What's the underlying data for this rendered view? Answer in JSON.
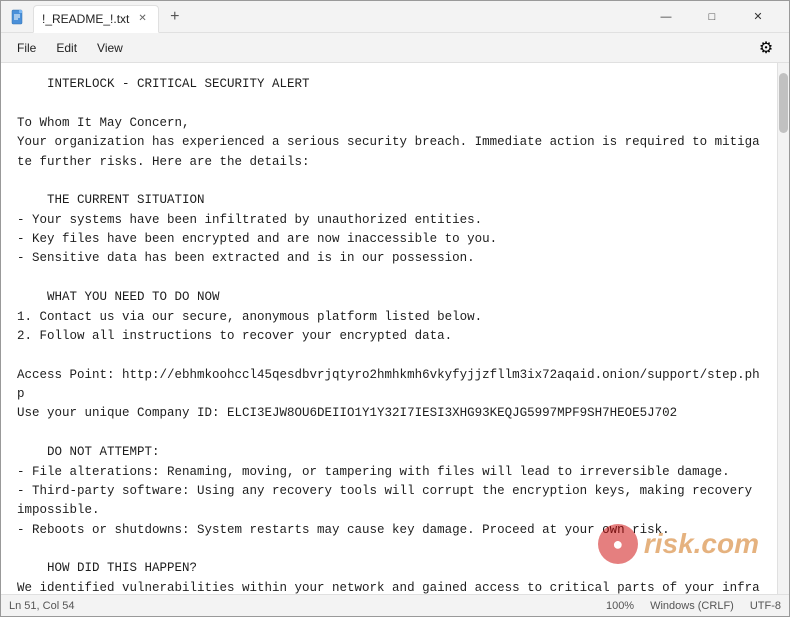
{
  "window": {
    "title": "!_README_!.txt",
    "icon": "notepad"
  },
  "tabs": [
    {
      "label": "!_README_!.txt",
      "active": true
    }
  ],
  "tab_add_label": "+",
  "window_controls": {
    "minimize": "—",
    "maximize": "□",
    "close": "✕"
  },
  "menu": {
    "items": [
      "File",
      "Edit",
      "View"
    ],
    "settings_icon": "⚙"
  },
  "content": "    INTERLOCK - CRITICAL SECURITY ALERT\n\nTo Whom It May Concern,\nYour organization has experienced a serious security breach. Immediate action is required to mitigate further risks. Here are the details:\n\n    THE CURRENT SITUATION\n- Your systems have been infiltrated by unauthorized entities.\n- Key files have been encrypted and are now inaccessible to you.\n- Sensitive data has been extracted and is in our possession.\n\n    WHAT YOU NEED TO DO NOW\n1. Contact us via our secure, anonymous platform listed below.\n2. Follow all instructions to recover your encrypted data.\n\nAccess Point: http://ebhmkoohccl45qesdbvrjqtyro2hmhkmh6vkyfyjjzfllm3ix72aqaid.onion/support/step.php\nUse your unique Company ID: ELCI3EJW8OU6DEIIO1Y1Y32I7IESI3XHG93KEQJG5997MPF9SH7HEOE5J702\n\n    DO NOT ATTEMPT:\n- File alterations: Renaming, moving, or tampering with files will lead to irreversible damage.\n- Third-party software: Using any recovery tools will corrupt the encryption keys, making recovery impossible.\n- Reboots or shutdowns: System restarts may cause key damage. Proceed at your own risk.\n\n    HOW DID THIS HAPPEN?\nWe identified vulnerabilities within your network and gained access to critical parts of your infrastructure. The following data categories have been extracted and are now at risk:\n- Personal records and client information\n- Financial statements, contracts, and legal documents\n- Internal communications\n- Backups and business-critical files",
  "status_bar": {
    "position": "Ln 51, Col 54",
    "zoom": "100%",
    "line_ending": "Windows (CRLF)",
    "encoding": "UTF-8"
  },
  "watermark": {
    "dot_text": "●",
    "site_text": "risk.com"
  }
}
